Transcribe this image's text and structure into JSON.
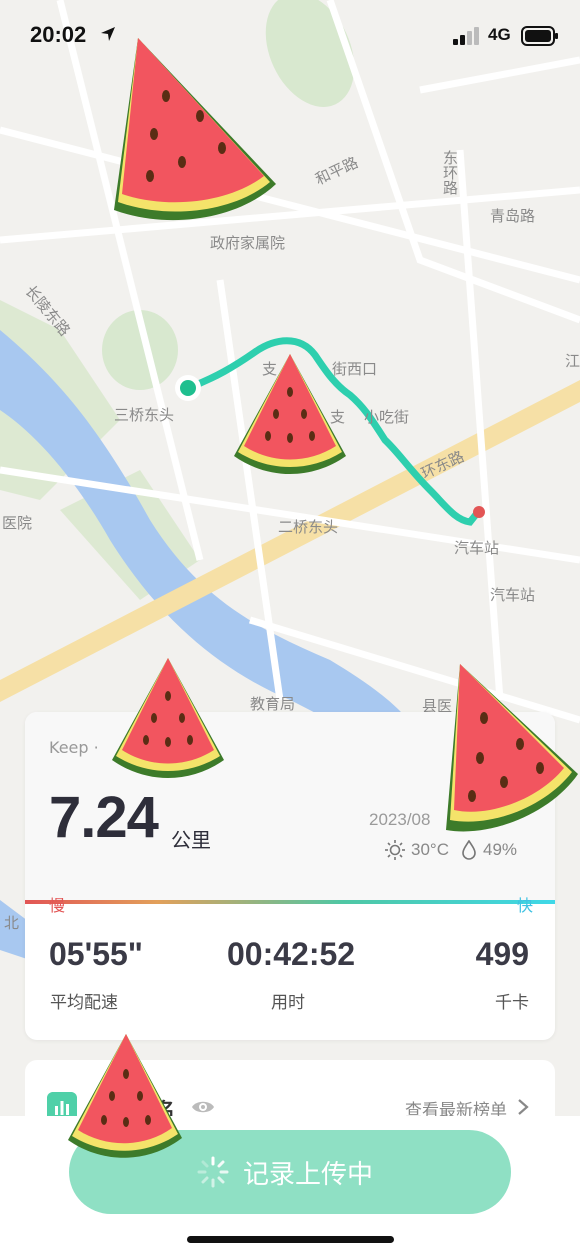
{
  "status": {
    "time": "20:02",
    "network": "4G"
  },
  "map_labels": [
    "和平路",
    "东环路",
    "青岛路",
    "政府家属院",
    "长陵东路",
    "支",
    "街西口",
    "江",
    "三桥东头",
    "支",
    "小吃街",
    "环东路",
    "医院",
    "二桥东头",
    "汽车站",
    "汽车站",
    "教育局",
    "县医",
    "北"
  ],
  "card": {
    "source": "Keep · ",
    "distance": "7.24",
    "distance_unit": "公里",
    "date": "2023/08",
    "temperature": "30°C",
    "humidity": "49%",
    "slow_label": "慢",
    "fast_label": "快",
    "stats": [
      {
        "value": "05'55\"",
        "label": "平均配速"
      },
      {
        "value": "00:42:52",
        "label": "用时"
      },
      {
        "value": "499",
        "label": "千卡"
      }
    ]
  },
  "rank": {
    "title": "名",
    "link": "查看最新榜单"
  },
  "upload_button": {
    "label": "记录上传中"
  },
  "colors": {
    "route": "#2ecfae",
    "accent": "#8fe0c4",
    "slow": "#e25555",
    "fast": "#3fc2e2"
  },
  "icons": [
    "location-arrow-icon",
    "signal-icon",
    "battery-icon",
    "sun-icon",
    "droplet-icon",
    "eye-icon",
    "chevron-right-icon",
    "spinner-icon",
    "chart-icon",
    "watermelon-sticker"
  ]
}
